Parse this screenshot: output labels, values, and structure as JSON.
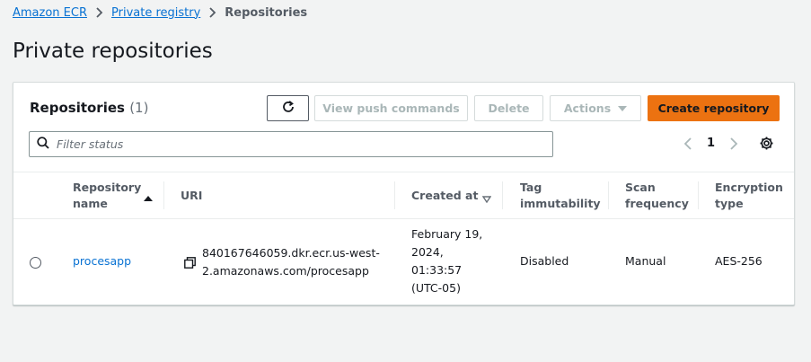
{
  "breadcrumb": {
    "items": [
      "Amazon ECR",
      "Private registry"
    ],
    "current": "Repositories"
  },
  "page": {
    "title": "Private repositories"
  },
  "repositories": {
    "header": {
      "title": "Repositories",
      "count": "(1)"
    },
    "buttons": {
      "refresh_icon": "refresh-icon",
      "view_push": "View push commands",
      "delete": "Delete",
      "actions": "Actions",
      "create": "Create repository"
    },
    "filter": {
      "placeholder": "Filter status",
      "value": ""
    },
    "pagination": {
      "page": "1"
    },
    "columns": [
      {
        "label_lines": [
          "Repository",
          "name"
        ],
        "sort": "ascending"
      },
      {
        "label_lines": [
          "URI"
        ]
      },
      {
        "label_lines": [
          "Created at"
        ],
        "sort": "sortable"
      },
      {
        "label_lines": [
          "Tag",
          "immutability"
        ]
      },
      {
        "label_lines": [
          "Scan",
          "frequency"
        ]
      },
      {
        "label_lines": [
          "Encryption",
          "type"
        ]
      }
    ],
    "rows": [
      {
        "name": "procesapp",
        "uri_lines": [
          "840167646059.dkr.ecr.us-west-",
          "2.amazonaws.com/procesapp"
        ],
        "created_lines": [
          "February 19,",
          "2024,",
          "01:33:57",
          "(UTC-05)"
        ],
        "tag_immutability": "Disabled",
        "scan_frequency": "Manual",
        "encryption": "AES-256"
      }
    ]
  },
  "colors": {
    "link": "#0972d3",
    "primary_button": "#ec7211",
    "background": "#f2f3f3"
  }
}
